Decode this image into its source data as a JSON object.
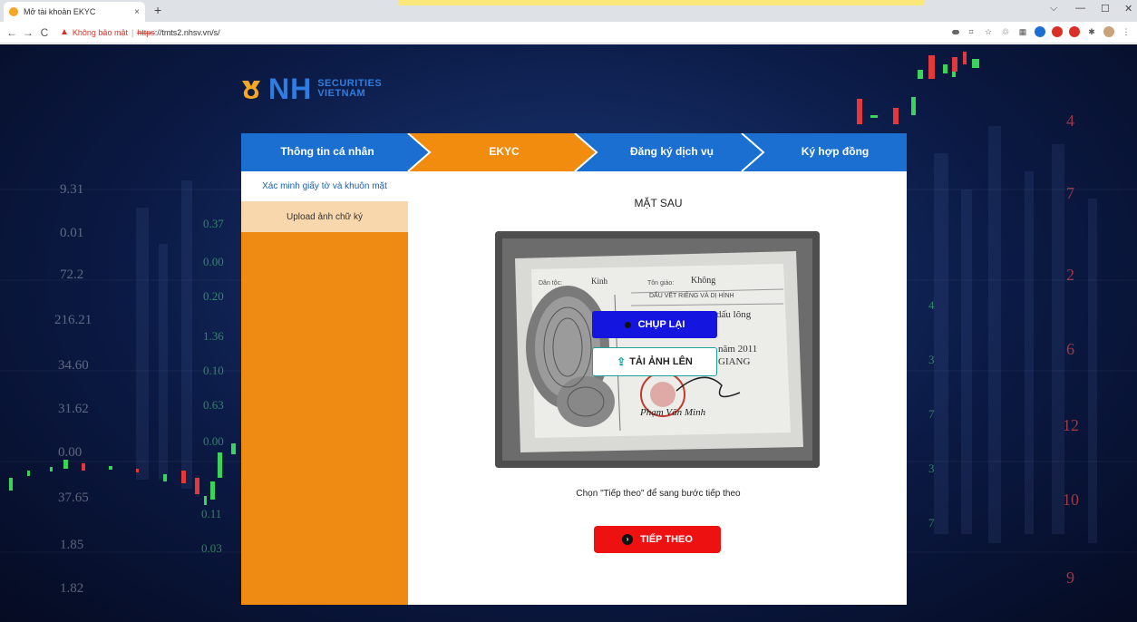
{
  "browser": {
    "tab_title": "Mở tài khoản EKYC",
    "tab_close": "×",
    "new_tab": "+",
    "back": "←",
    "forward": "→",
    "reload": "C",
    "security_icon": "▲",
    "security_label": "Không bảo mật",
    "separator": "|",
    "url_protocol": "https",
    "url_rest": "://tmts2.nhsv.vn/s/",
    "minimize": "—",
    "maximize": "☐",
    "close": "✕",
    "dropdown": "⌵"
  },
  "background_numbers": {
    "left": [
      "9.31",
      "0.01",
      "72.2",
      "216.21",
      "34.60",
      "31.62",
      "0.00",
      "37.65",
      "1.85",
      "1.82"
    ],
    "left_green": [
      "0.37",
      "0.00",
      "0.20",
      "1.36",
      "0.10",
      "0.63",
      "0.00",
      "0.11",
      "0.03"
    ],
    "right": [
      "4",
      "7",
      "2",
      "6",
      "12",
      "10",
      "9"
    ],
    "right_green": [
      "4",
      "3",
      "7",
      "3",
      "7"
    ]
  },
  "logo": {
    "brand": "NH",
    "line1": "SECURITIES",
    "line2": "VIETNAM"
  },
  "steps": [
    {
      "label": "Thông tin cá nhân",
      "state": "done"
    },
    {
      "label": "EKYC",
      "state": "active"
    },
    {
      "label": "Đăng ký dịch vụ",
      "state": "pending"
    },
    {
      "label": "Ký hợp đồng",
      "state": "pending"
    }
  ],
  "sidebar": {
    "items": [
      {
        "label": "Xác minh giấy tờ và khuôn mặt",
        "active": true
      },
      {
        "label": "Upload ảnh chữ ký",
        "active": false
      }
    ]
  },
  "main": {
    "title": "MẶT SAU",
    "retake_label": "CHỤP LẠI",
    "upload_label": "TẢI ẢNH LÊN",
    "hint": "Chọn \"Tiếp theo\" để sang bước tiếp theo",
    "next_label": "TIẾP THEO"
  },
  "id_card": {
    "ethnic_label": "Dân tộc:",
    "ethnic_value": "Kinh",
    "religion_label": "Tôn giáo:",
    "religion_value": "Không",
    "features_title": "DẤU VẾT RIÊNG VÀ DỊ HÌNH",
    "features_partial": "dấu lông",
    "year_partial": "năm 2011",
    "place_partial": "GIANG",
    "signature": "Phạm Văn Minh"
  },
  "colors": {
    "step_blue": "#1a6fd1",
    "step_orange": "#f28c0f",
    "sidebar_orange": "#ef8a12",
    "retake_blue": "#1515e0",
    "next_red": "#ee1111",
    "upload_teal": "#1aa39a"
  }
}
